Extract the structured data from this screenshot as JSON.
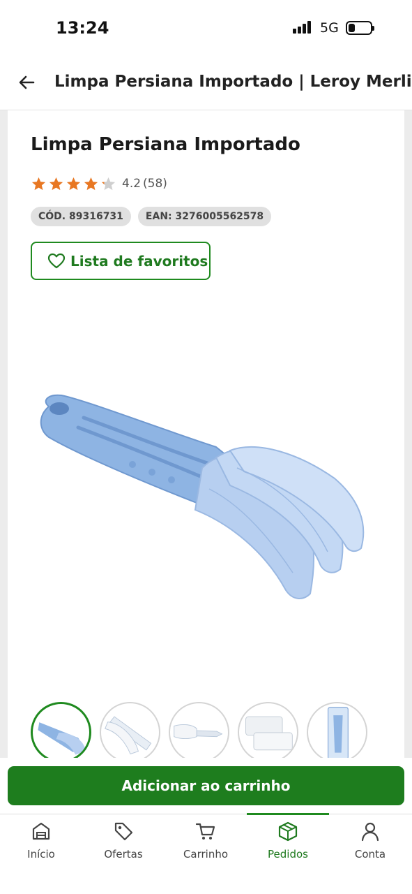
{
  "status_bar": {
    "time": "13:24",
    "network": "5G",
    "battery_level": 0.3
  },
  "header": {
    "back_icon": "arrow-left-icon",
    "title": "Limpa Persiana Importado | Leroy Merlin"
  },
  "product": {
    "title": "Limpa Persiana Importado",
    "rating": {
      "value": "4.2",
      "count": "(58)",
      "stars": 4.2,
      "max_stars": 5,
      "star_color": "#e87722",
      "empty_star_color": "#cfcfcf"
    },
    "codes": {
      "cod": "CÓD. 89316731",
      "ean": "EAN: 3276005562578"
    },
    "favorites_label": "Lista de favoritos",
    "image_alt_icon": "blind-cleaner-brush-image",
    "thumbnails": [
      {
        "icon": "thumb-blue-brush",
        "selected": true
      },
      {
        "icon": "thumb-white-brush",
        "selected": false
      },
      {
        "icon": "thumb-white-brush-side",
        "selected": false
      },
      {
        "icon": "thumb-microfiber-pads",
        "selected": false
      },
      {
        "icon": "thumb-packaging",
        "selected": false
      }
    ]
  },
  "cart": {
    "add_label": "Adicionar ao carrinho"
  },
  "nav": {
    "items": [
      {
        "label": "Início",
        "icon": "home-icon",
        "active": false
      },
      {
        "label": "Ofertas",
        "icon": "tag-icon",
        "active": false
      },
      {
        "label": "Carrinho",
        "icon": "cart-icon",
        "active": false
      },
      {
        "label": "Pedidos",
        "icon": "box-icon",
        "active": true
      },
      {
        "label": "Conta",
        "icon": "user-icon",
        "active": false
      }
    ]
  },
  "colors": {
    "brand_green": "#1e7d1e",
    "accent_orange": "#e87722"
  }
}
